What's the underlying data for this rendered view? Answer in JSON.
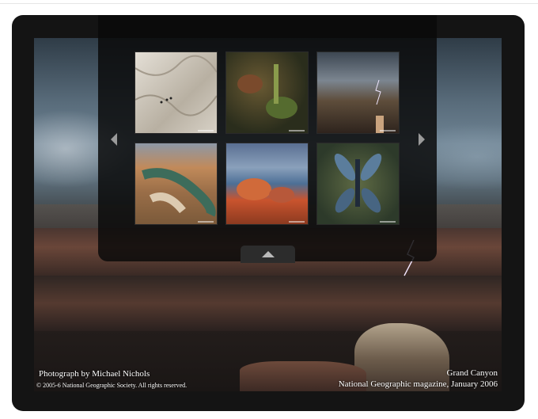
{
  "photo": {
    "credit_line": "Photograph by Michael Nichols",
    "copyright_line": "© 2005-6 National Geographic Society. All rights reserved.",
    "location": "Grand Canyon",
    "source": "National Geographic magazine, January 2006"
  },
  "thumbnails": [
    {
      "name": "thumbnail-desert-dunes",
      "colors": [
        "#d9d4ca",
        "#b8b1a5"
      ]
    },
    {
      "name": "thumbnail-jungle-plants",
      "colors": [
        "#4a4a2a",
        "#2b2e1c"
      ]
    },
    {
      "name": "thumbnail-canyon-storm",
      "colors": [
        "#6c7680",
        "#3a3128"
      ]
    },
    {
      "name": "thumbnail-river-bend",
      "colors": [
        "#b07d55",
        "#3f6c58"
      ]
    },
    {
      "name": "thumbnail-red-rocks-lake",
      "colors": [
        "#c9542e",
        "#4c6f96"
      ]
    },
    {
      "name": "thumbnail-dragonfly",
      "colors": [
        "#4f5b38",
        "#2d3a2a"
      ]
    }
  ],
  "icons": {
    "prev": "chevron-left-icon",
    "next": "chevron-right-icon",
    "collapse": "chevron-up-icon"
  }
}
